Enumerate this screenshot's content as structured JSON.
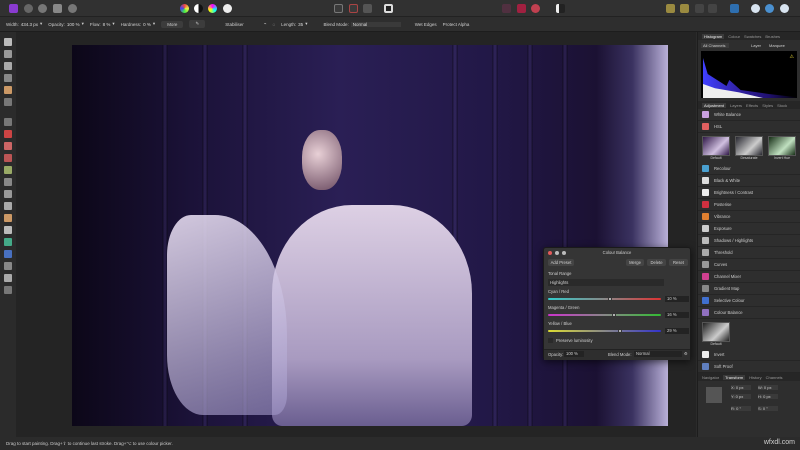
{
  "context_bar": {
    "width_label": "Width:",
    "width_value": "434.3 px",
    "opacity_label": "Opacity:",
    "opacity_value": "100 %",
    "flow_label": "Flow:",
    "flow_value": "8 %",
    "hardness_label": "Hardness:",
    "hardness_value": "0 %",
    "more_label": "More",
    "stabiliser_label": "Stabiliser",
    "length_label": "Length:",
    "length_value": "35",
    "blend_label": "Blend Mode:",
    "blend_value": "Normal",
    "wet_edges_label": "Wet Edges",
    "protect_alpha_label": "Protect Alpha"
  },
  "status_text": "Drag to start painting. Drag+⇧ to continue last stroke. Drag+⌥ to use colour picker.",
  "right_panel": {
    "top_tabs": [
      "Histogram",
      "Colour",
      "Swatches",
      "Brushes"
    ],
    "channels": "All Channels",
    "layer_label": "Layer",
    "marquee_label": "Marquee",
    "adj_tabs": [
      "Adjustment",
      "Layers",
      "Effects",
      "Styles",
      "Stock"
    ],
    "adjustments_top": [
      {
        "label": "White Balance",
        "color": "#c9a0e0"
      },
      {
        "label": "HSL",
        "color": "#e06060"
      }
    ],
    "presets": [
      "Default",
      "Desaturate",
      "Invert Hue"
    ],
    "adjustments": [
      {
        "label": "Recolour",
        "color": "#4aa0d0"
      },
      {
        "label": "Black & White",
        "color": "#dddddd"
      },
      {
        "label": "Brightness / Contrast",
        "color": "#eeeeee"
      },
      {
        "label": "Posterise",
        "color": "#d03040"
      },
      {
        "label": "Vibrance",
        "color": "#e08030"
      },
      {
        "label": "Exposure",
        "color": "#cccccc"
      },
      {
        "label": "Shadows / Highlights",
        "color": "#bbbbbb"
      },
      {
        "label": "Threshold",
        "color": "#aaaaaa"
      },
      {
        "label": "Curves",
        "color": "#999999"
      },
      {
        "label": "Channel Mixer",
        "color": "#d04090"
      },
      {
        "label": "Gradient Map",
        "color": "#888888"
      },
      {
        "label": "Selective Colour",
        "color": "#4070d0"
      },
      {
        "label": "Colour Balance",
        "color": "#9070c0"
      }
    ],
    "cb_preset": "Default",
    "adjustments_bottom": [
      {
        "label": "Invert",
        "color": "#eeeeee"
      },
      {
        "label": "Soft Proof",
        "color": "#6080c0"
      }
    ],
    "bottom_tabs": [
      "Navigator",
      "Transform",
      "History",
      "Channels"
    ],
    "transform": {
      "x": "X: 0 px",
      "y": "Y: 0 px",
      "w": "W: 0 px",
      "h": "H: 0 px",
      "r": "R: 0 °",
      "s": "S: 0 °"
    }
  },
  "dialog": {
    "title": "Colour Balance",
    "add_preset": "Add Preset",
    "merge": "Merge",
    "delete": "Delete",
    "reset": "Reset",
    "tonal_range_label": "Tonal Range",
    "tonal_range_value": "Highlights",
    "sliders": [
      {
        "label": "Cyan / Red",
        "value": "10 %",
        "fraction": 0.55
      },
      {
        "label": "Magenta / Green",
        "value": "16 %",
        "fraction": 0.58
      },
      {
        "label": "Yellow / Blue",
        "value": "29 %",
        "fraction": 0.64
      }
    ],
    "preserve_label": "Preserve luminosity",
    "opacity_label": "Opacity:",
    "opacity_value": "100 %",
    "blend_label": "Blend Mode:",
    "blend_value": "Normal"
  },
  "watermark": "wfxdl.com"
}
